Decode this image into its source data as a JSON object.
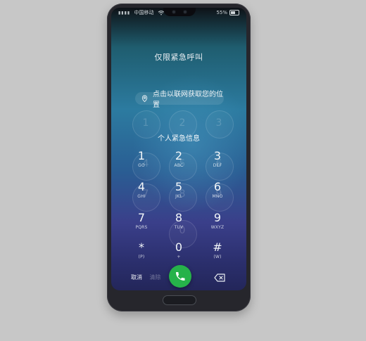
{
  "status": {
    "carrier": "中国移动",
    "battery": "55%"
  },
  "screen": {
    "title": "仅限紧急呼叫",
    "location": "点击以联网获取您的位置",
    "emergency_info": "个人紧急信息"
  },
  "keypad": {
    "keys": [
      {
        "digit": "1",
        "letters": "GO"
      },
      {
        "digit": "2",
        "letters": "ABC"
      },
      {
        "digit": "3",
        "letters": "DEF"
      },
      {
        "digit": "4",
        "letters": "GHI"
      },
      {
        "digit": "5",
        "letters": "JKL"
      },
      {
        "digit": "6",
        "letters": "MNO"
      },
      {
        "digit": "7",
        "letters": "PQRS"
      },
      {
        "digit": "8",
        "letters": "TUV"
      },
      {
        "digit": "9",
        "letters": "WXYZ"
      },
      {
        "digit": "*",
        "letters": "(P)"
      },
      {
        "digit": "0",
        "letters": "+"
      },
      {
        "digit": "#",
        "letters": "(W)"
      }
    ],
    "ghost_digits": [
      "1",
      "2",
      "3",
      "4",
      "5",
      "6",
      "7",
      "8",
      "9",
      "0"
    ]
  },
  "actions": {
    "cancel": "取消",
    "clear": "清除"
  },
  "icons": {
    "wifi": "wifi-icon",
    "battery": "battery-icon",
    "location": "location-pin-icon",
    "call": "phone-icon",
    "backspace": "backspace-icon"
  },
  "colors": {
    "call_green": "#26b24a"
  }
}
